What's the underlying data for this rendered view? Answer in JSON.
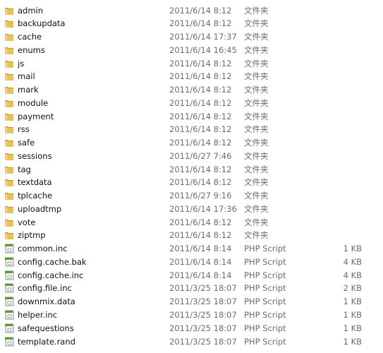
{
  "colors": {
    "folder": "#e8c15a",
    "folder_dark": "#c9982f",
    "script_green": "#5a9a2e"
  },
  "files": [
    {
      "name": "admin",
      "date": "2011/6/14 8:12",
      "type": "文件夹",
      "size": "",
      "icon": "folder-icon"
    },
    {
      "name": "backupdata",
      "date": "2011/6/14 8:12",
      "type": "文件夹",
      "size": "",
      "icon": "folder-icon"
    },
    {
      "name": "cache",
      "date": "2011/6/14 17:37",
      "type": "文件夹",
      "size": "",
      "icon": "folder-icon"
    },
    {
      "name": "enums",
      "date": "2011/6/14 16:45",
      "type": "文件夹",
      "size": "",
      "icon": "folder-icon"
    },
    {
      "name": "js",
      "date": "2011/6/14 8:12",
      "type": "文件夹",
      "size": "",
      "icon": "folder-icon"
    },
    {
      "name": "mail",
      "date": "2011/6/14 8:12",
      "type": "文件夹",
      "size": "",
      "icon": "folder-icon"
    },
    {
      "name": "mark",
      "date": "2011/6/14 8:12",
      "type": "文件夹",
      "size": "",
      "icon": "folder-icon"
    },
    {
      "name": "module",
      "date": "2011/6/14 8:12",
      "type": "文件夹",
      "size": "",
      "icon": "folder-icon"
    },
    {
      "name": "payment",
      "date": "2011/6/14 8:12",
      "type": "文件夹",
      "size": "",
      "icon": "folder-icon"
    },
    {
      "name": "rss",
      "date": "2011/6/14 8:12",
      "type": "文件夹",
      "size": "",
      "icon": "folder-icon"
    },
    {
      "name": "safe",
      "date": "2011/6/14 8:12",
      "type": "文件夹",
      "size": "",
      "icon": "folder-icon"
    },
    {
      "name": "sessions",
      "date": "2011/6/27 7:46",
      "type": "文件夹",
      "size": "",
      "icon": "folder-icon"
    },
    {
      "name": "tag",
      "date": "2011/6/14 8:12",
      "type": "文件夹",
      "size": "",
      "icon": "folder-icon"
    },
    {
      "name": "textdata",
      "date": "2011/6/14 8:12",
      "type": "文件夹",
      "size": "",
      "icon": "folder-icon"
    },
    {
      "name": "tplcache",
      "date": "2011/6/27 9:16",
      "type": "文件夹",
      "size": "",
      "icon": "folder-icon"
    },
    {
      "name": "uploadtmp",
      "date": "2011/6/14 17:36",
      "type": "文件夹",
      "size": "",
      "icon": "folder-icon"
    },
    {
      "name": "vote",
      "date": "2011/6/14 8:12",
      "type": "文件夹",
      "size": "",
      "icon": "folder-icon"
    },
    {
      "name": "ziptmp",
      "date": "2011/6/14 8:12",
      "type": "文件夹",
      "size": "",
      "icon": "folder-icon"
    },
    {
      "name": "common.inc",
      "date": "2011/6/14 8:14",
      "type": "PHP Script",
      "size": "1 KB",
      "icon": "php-file-icon"
    },
    {
      "name": "config.cache.bak",
      "date": "2011/6/14 8:14",
      "type": "PHP Script",
      "size": "4 KB",
      "icon": "php-file-icon"
    },
    {
      "name": "config.cache.inc",
      "date": "2011/6/14 8:14",
      "type": "PHP Script",
      "size": "4 KB",
      "icon": "php-file-icon"
    },
    {
      "name": "config.file.inc",
      "date": "2011/3/25 18:07",
      "type": "PHP Script",
      "size": "2 KB",
      "icon": "php-file-icon"
    },
    {
      "name": "downmix.data",
      "date": "2011/3/25 18:07",
      "type": "PHP Script",
      "size": "1 KB",
      "icon": "php-file-icon"
    },
    {
      "name": "helper.inc",
      "date": "2011/3/25 18:07",
      "type": "PHP Script",
      "size": "1 KB",
      "icon": "php-file-icon"
    },
    {
      "name": "safequestions",
      "date": "2011/3/25 18:07",
      "type": "PHP Script",
      "size": "1 KB",
      "icon": "php-file-icon"
    },
    {
      "name": "template.rand",
      "date": "2011/3/25 18:07",
      "type": "PHP Script",
      "size": "1 KB",
      "icon": "php-file-icon"
    }
  ]
}
